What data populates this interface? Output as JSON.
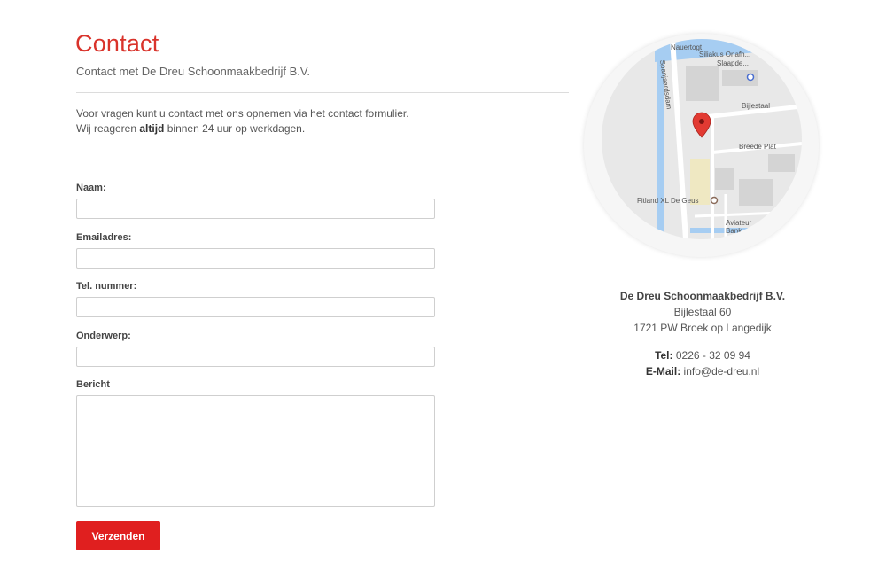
{
  "header": {
    "title": "Contact",
    "subtitle": "Contact met De Dreu Schoonmaakbedrijf B.V."
  },
  "intro": {
    "line1": "Voor vragen kunt u contact met ons opnemen via het contact formulier.",
    "line2_prefix": "Wij reageren ",
    "line2_bold": "altijd",
    "line2_suffix": " binnen 24 uur op werkdagen."
  },
  "form": {
    "name_label": "Naam:",
    "name_value": "",
    "email_label": "Emailadres:",
    "email_value": "",
    "phone_label": "Tel. nummer:",
    "phone_value": "",
    "subject_label": "Onderwerp:",
    "subject_value": "",
    "message_label": "Bericht",
    "message_value": "",
    "submit_label": "Verzenden"
  },
  "map": {
    "streets": {
      "nauertogt": "Nauertogt",
      "spanjaardsdam": "Spanjaardsdam",
      "bijlestaal": "Bijlestaal",
      "breede_plat": "Breede Plat",
      "fitland": "Fitland XL De Geus",
      "siliakus": "Siliakus Onafh...",
      "slaapde": "Slaapde...",
      "aviateur": "Aviateur",
      "bank": "Bank"
    },
    "colors": {
      "land": "#e8e8e8",
      "water": "#a6cdf2",
      "road": "#ffffff",
      "building": "#d4d4d4",
      "field": "#efe8c2",
      "pin": "#e23a32"
    }
  },
  "contact": {
    "company": "De Dreu Schoonmaakbedrijf B.V.",
    "street": "Bijlestaal 60",
    "city": "1721 PW Broek op Langedijk",
    "tel_label": "Tel:",
    "tel_value": "0226 - 32 09 94",
    "email_label": "E-Mail:",
    "email_value": "info@de-dreu.nl"
  }
}
